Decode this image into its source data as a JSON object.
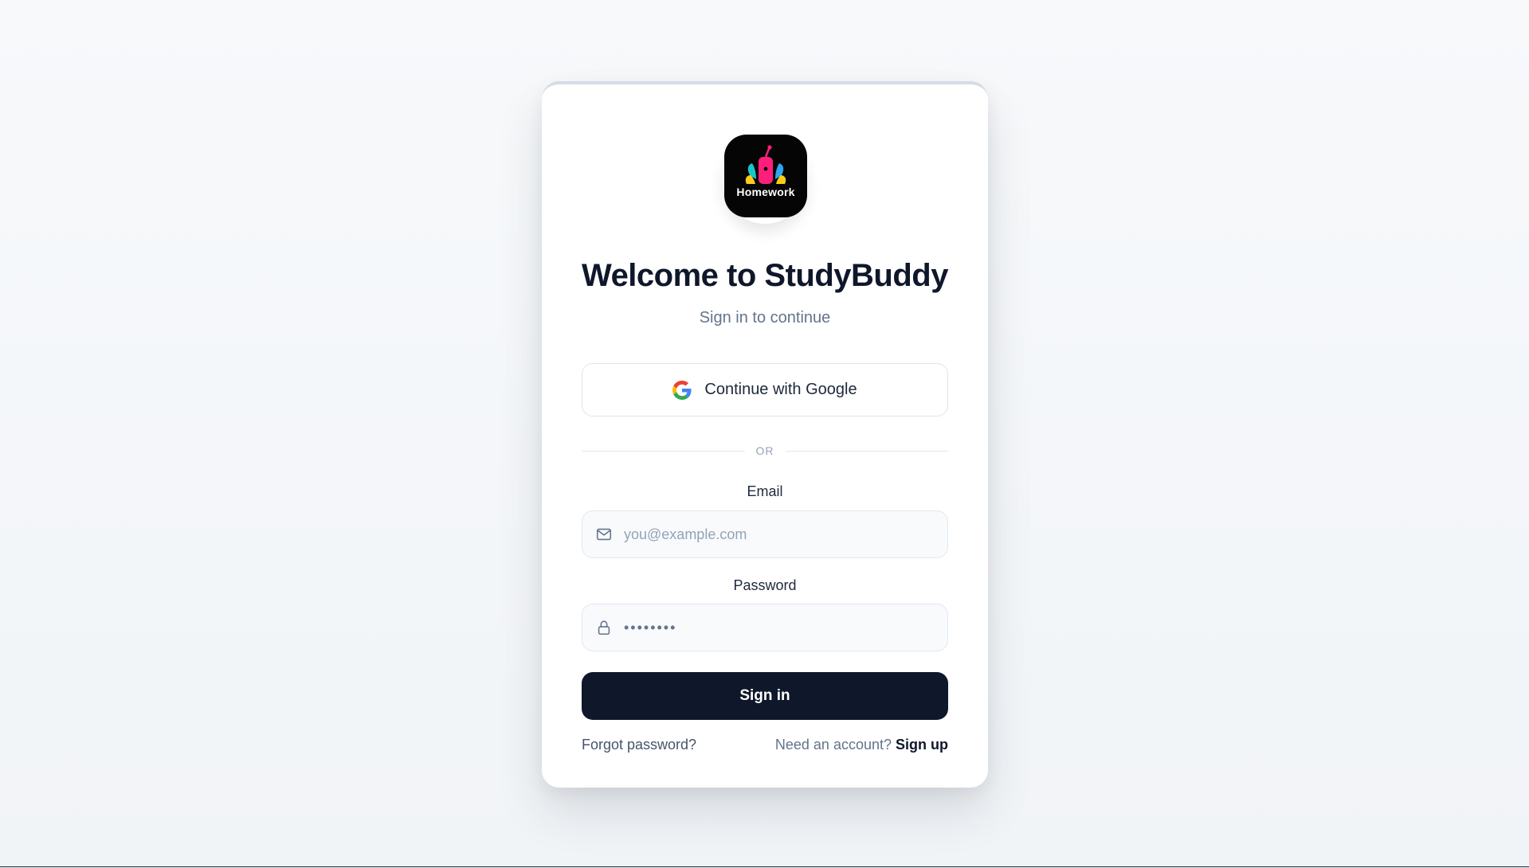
{
  "app": {
    "logo_text": "Homework",
    "title": "Welcome to StudyBuddy",
    "subtitle": "Sign in to continue"
  },
  "auth": {
    "google_button_label": "Continue with Google",
    "divider_text": "OR",
    "email": {
      "label": "Email",
      "placeholder": "you@example.com",
      "value": ""
    },
    "password": {
      "label": "Password",
      "value": "••••••••"
    },
    "signin_label": "Sign in",
    "forgot_label": "Forgot password?",
    "need_account_text": "Need an account?",
    "signup_label": "Sign up"
  },
  "icons": {
    "google": "google-icon",
    "email": "mail-icon",
    "password": "lock-icon"
  },
  "colors": {
    "primary": "#0f172a",
    "muted": "#64748b",
    "border": "#e2e8f0",
    "field_bg": "#f8fafc",
    "logo_bg": "#050505",
    "logo_pink": "#ff1f7a",
    "logo_teal": "#19c6c9",
    "logo_yellow": "#ffcc1a",
    "logo_blue": "#2ba6f5"
  }
}
